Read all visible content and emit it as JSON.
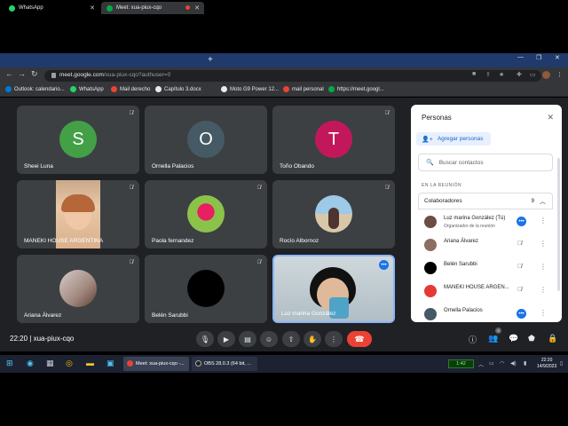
{
  "browser": {
    "tabs": [
      {
        "label": "WhatsApp",
        "icon": "whatsapp-icon",
        "color": "#25d366"
      },
      {
        "label": "Meet: xua-piux-cqo",
        "icon": "meet-icon",
        "color": "#00ac47"
      }
    ],
    "url_domain": "meet.google.com",
    "url_path": "/xua-piux-cqo?authuser=0",
    "bookmarks": [
      {
        "label": "Outlook: calendario...",
        "color": "#0078d4"
      },
      {
        "label": "WhatsApp",
        "color": "#25d366"
      },
      {
        "label": "Mail derecho",
        "color": "#ea4335"
      },
      {
        "label": "Capítulo 3.docx",
        "color": "#e8eaed"
      },
      {
        "label": "Moto G9 Power 12...",
        "color": "#e8eaed"
      },
      {
        "label": "mail personal",
        "color": "#ea4335"
      },
      {
        "label": "https://meet.googl...",
        "color": "#00ac47"
      }
    ]
  },
  "tiles": [
    {
      "name": "Sheei Luna",
      "initial": "S",
      "color": "#43a047"
    },
    {
      "name": "Ornella Palacios",
      "initial": "O",
      "color": "#455a64"
    },
    {
      "name": "Toño Obando",
      "initial": "T",
      "color": "#c2185b"
    },
    {
      "name": "MANEKI HOUSE ARGENTINA"
    },
    {
      "name": "Paola fernandez"
    },
    {
      "name": "Rocío Albornoz"
    },
    {
      "name": "Ariana Álvarez"
    },
    {
      "name": "Belén Sarubbi"
    },
    {
      "name": "Luz marina González"
    }
  ],
  "meeting": {
    "time": "22:20",
    "separator": "|",
    "code": "xua-piux-cqo"
  },
  "panel": {
    "title": "Personas",
    "add_label": "Agregar personas",
    "search_placeholder": "Buscar contactos",
    "section": "EN LA REUNIÓN",
    "group_label": "Colaboradores",
    "group_count": "9",
    "people": [
      {
        "name": "Luz marina González (Tú)",
        "role": "Organizador de la reunión",
        "color": "#6d4c41"
      },
      {
        "name": "Ariana Álvarez",
        "role": "",
        "color": "#8d6e63"
      },
      {
        "name": "Belén Sarubbi",
        "role": "",
        "color": "#000000"
      },
      {
        "name": "MANEKI HOUSE ARGEN...",
        "role": "",
        "color": "#e53935"
      },
      {
        "name": "Ornella Palacios",
        "role": "",
        "color": "#455a64"
      }
    ]
  },
  "taskbar": {
    "windows": [
      {
        "label": "Meet: xua-piux-cqo -...",
        "color": "#ea4335"
      },
      {
        "label": "OBS 28.0.3 (64 bit, ...",
        "color": "#202020"
      }
    ],
    "cpu": "1:42",
    "clock_time": "22:20",
    "clock_date": "14/9/2023"
  }
}
